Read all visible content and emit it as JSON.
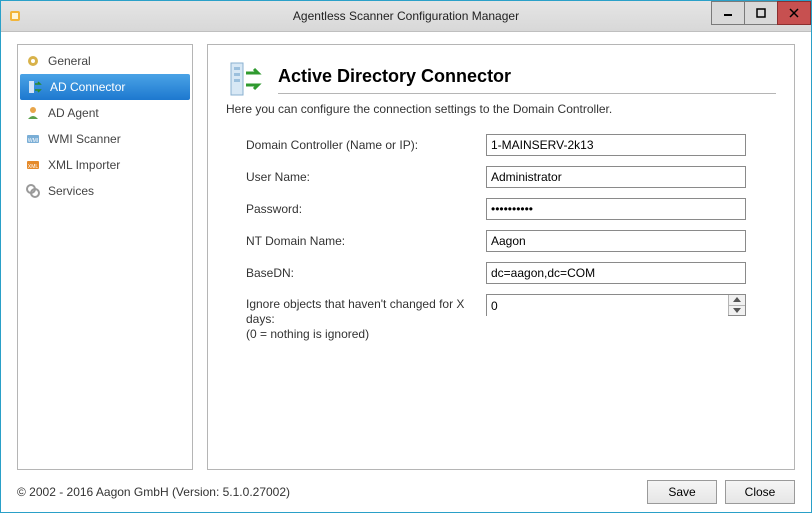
{
  "window": {
    "title": "Agentless Scanner Configuration Manager"
  },
  "sidebar": {
    "items": [
      {
        "label": "General",
        "selected": false,
        "icon": "gear-icon"
      },
      {
        "label": "AD Connector",
        "selected": true,
        "icon": "ad-connector-icon"
      },
      {
        "label": "AD Agent",
        "selected": false,
        "icon": "ad-agent-icon"
      },
      {
        "label": "WMI Scanner",
        "selected": false,
        "icon": "wmi-icon"
      },
      {
        "label": "XML Importer",
        "selected": false,
        "icon": "xml-icon"
      },
      {
        "label": "Services",
        "selected": false,
        "icon": "services-icon"
      }
    ]
  },
  "main": {
    "title": "Active Directory Connector",
    "description": "Here you can configure the connection settings to the Domain Controller.",
    "fields": {
      "domain_controller": {
        "label": "Domain Controller (Name or IP):",
        "value": "1-MAINSERV-2k13"
      },
      "user_name": {
        "label": "User Name:",
        "value": "Administrator"
      },
      "password": {
        "label": "Password:",
        "value": "••••••••••"
      },
      "nt_domain": {
        "label": "NT Domain Name:",
        "value": "Aagon"
      },
      "base_dn": {
        "label": "BaseDN:",
        "value": "dc=aagon,dc=COM"
      },
      "ignore_days": {
        "label_line1": "Ignore objects that haven't changed for X days:",
        "label_line2": "(0 = nothing is ignored)",
        "value": "0"
      }
    }
  },
  "footer": {
    "copyright": "© 2002 - 2016 Aagon GmbH (Version: 5.1.0.27002)",
    "save": "Save",
    "close": "Close"
  }
}
